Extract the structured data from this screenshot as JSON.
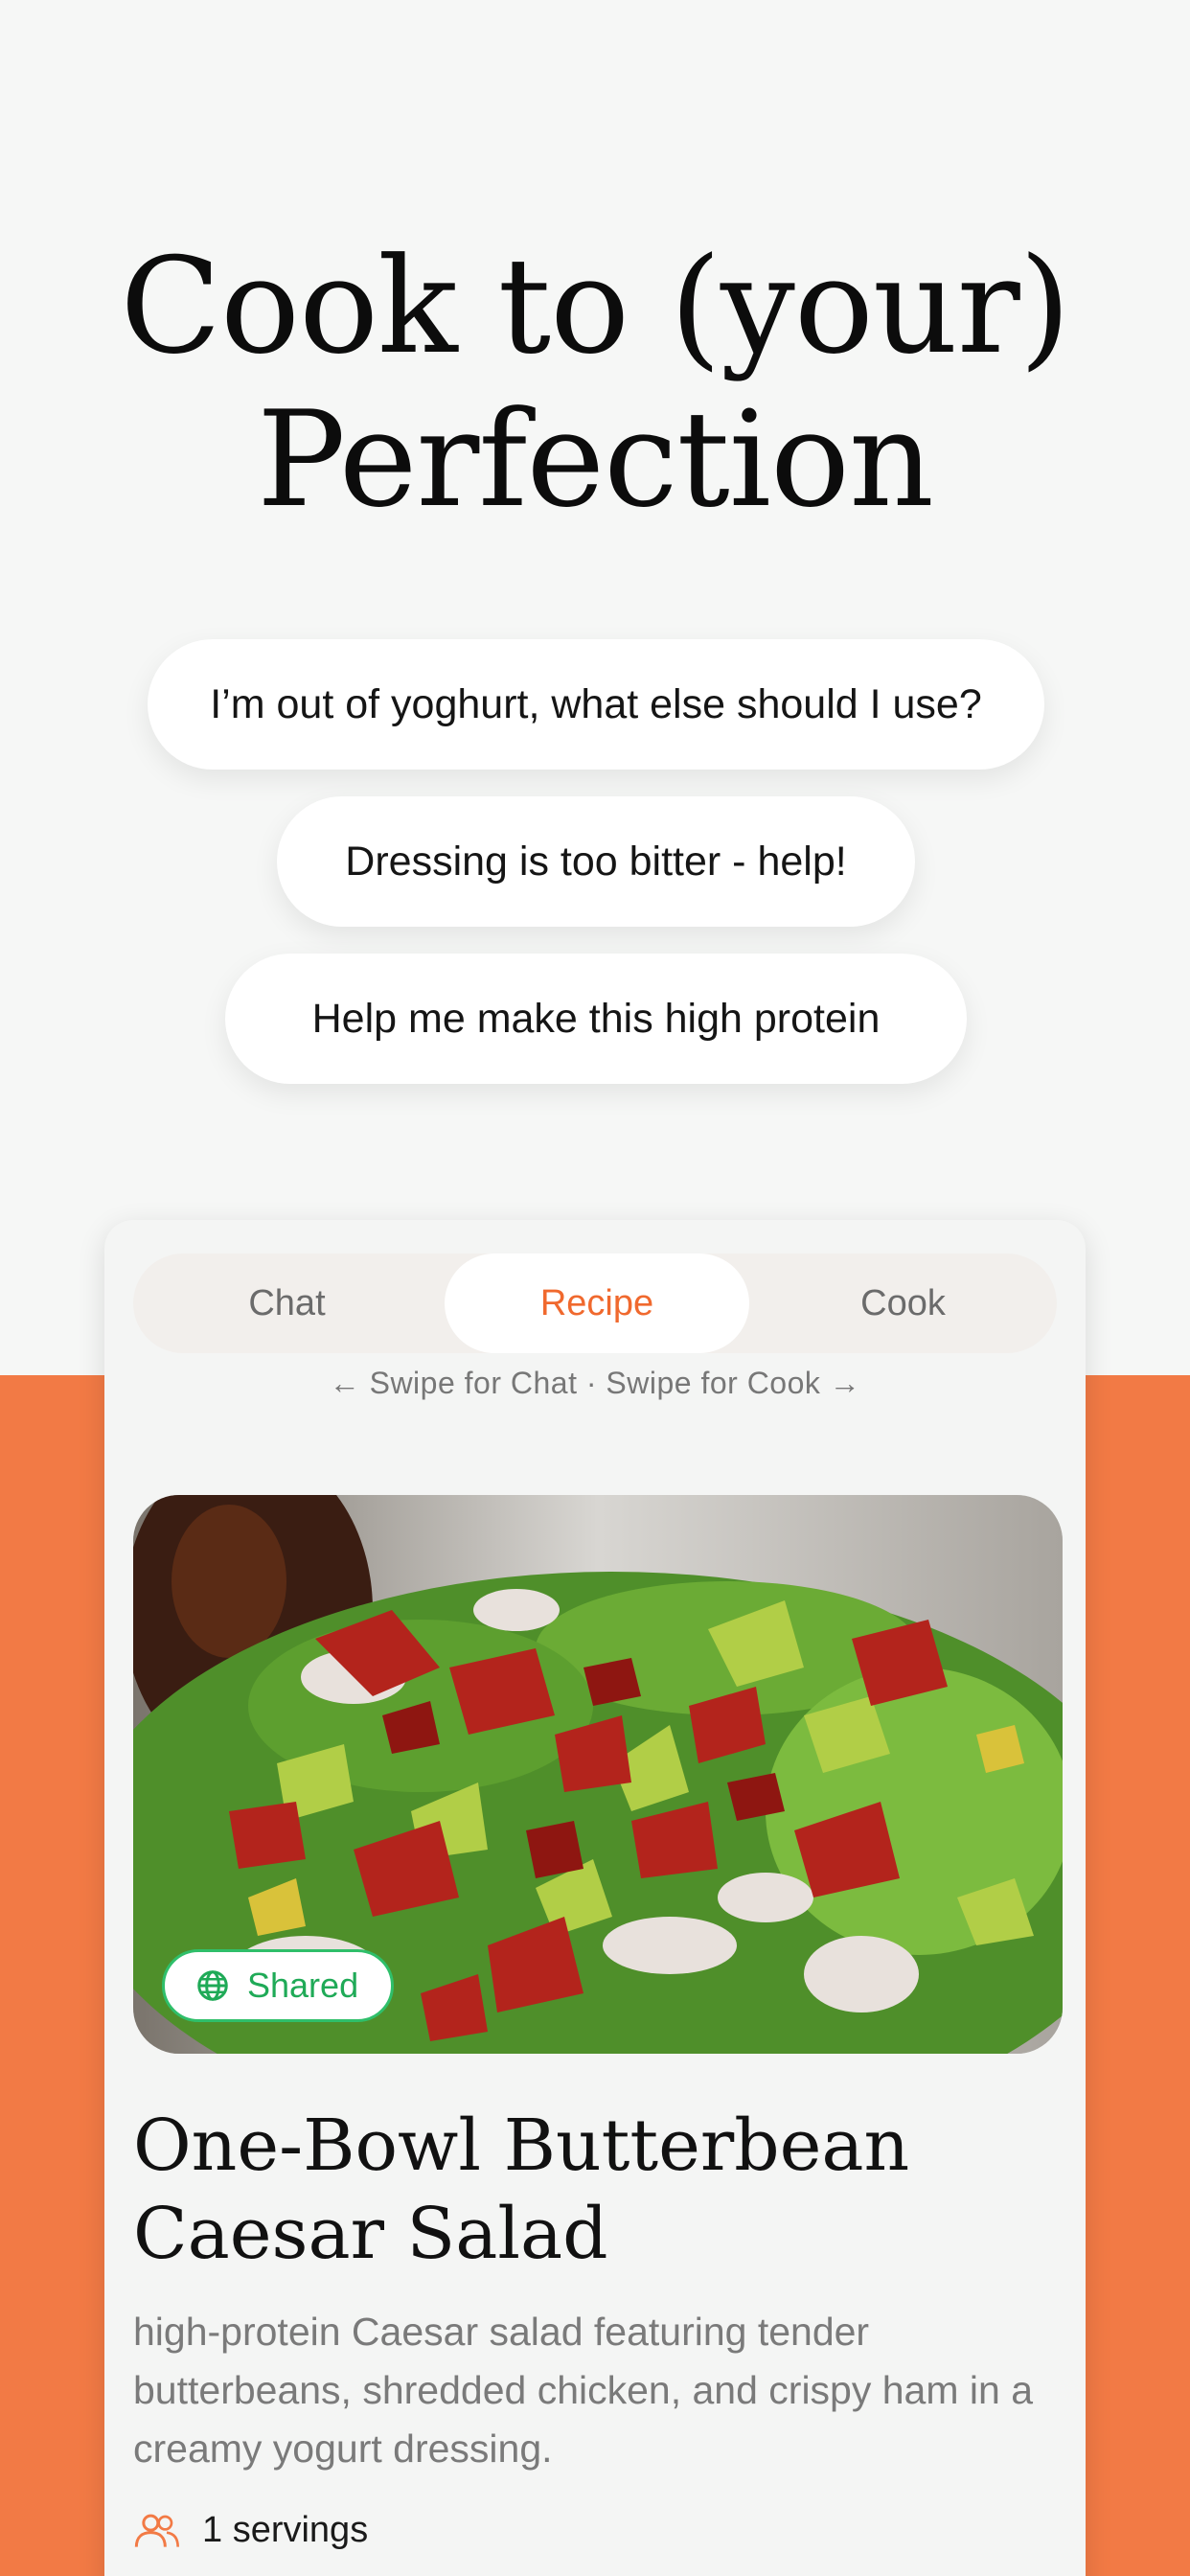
{
  "hero": {
    "title_line1": "Cook to (your)",
    "title_line2": "Perfection"
  },
  "suggestions": [
    "I’m out of yoghurt, what else should I use?",
    "Dressing is too bitter - help!",
    "Help me make this high protein"
  ],
  "card": {
    "tabs": [
      {
        "label": "Chat",
        "active": false
      },
      {
        "label": "Recipe",
        "active": true
      },
      {
        "label": "Cook",
        "active": false
      }
    ],
    "swipe_hint": "← Swipe for Chat · Swipe for Cook →",
    "badge": "Shared",
    "recipe_title_line1": "One-Bowl Butterbean",
    "recipe_title_line2": "Caesar Salad",
    "description": "high-protein Caesar salad featuring tender butterbeans, shredded chicken, and crispy ham in a creamy yogurt dressing.",
    "servings": "1 servings"
  },
  "colors": {
    "accent": "#f27a45",
    "active_tab": "#f0692e",
    "shared_green": "#2fbf6a",
    "background": "#f6f7f6"
  },
  "icons": {
    "badge": "globe-icon",
    "servings": "people-icon"
  }
}
